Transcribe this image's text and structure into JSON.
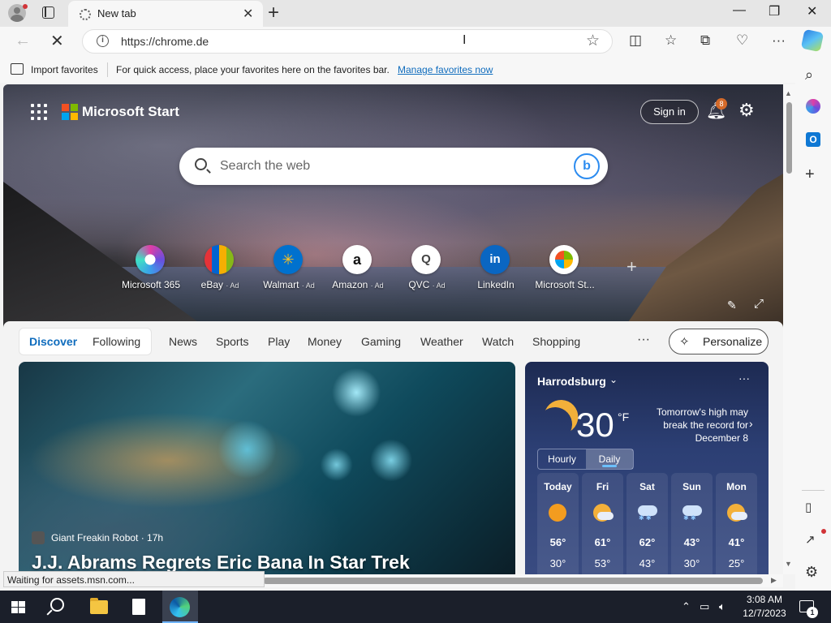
{
  "browser": {
    "tab": {
      "title": "New tab"
    },
    "address": {
      "url": "https://chrome.de"
    },
    "favorites_bar": {
      "import_label": "Import favorites",
      "message": "For quick access, place your favorites here on the favorites bar.",
      "manage_link": "Manage favorites now"
    },
    "status_text": "Waiting for assets.msn.com..."
  },
  "header": {
    "brand": "Microsoft Start",
    "sign_in": "Sign in",
    "notification_count": "8",
    "search_placeholder": "Search the web"
  },
  "quick_links": [
    {
      "label": "Microsoft 365",
      "ad": "",
      "icon": "m365-icon"
    },
    {
      "label": "eBay",
      "ad": "· Ad",
      "icon": "ebay-icon"
    },
    {
      "label": "Walmart",
      "ad": "· Ad",
      "icon": "walmart-icon"
    },
    {
      "label": "Amazon",
      "ad": "· Ad",
      "icon": "amazon-icon"
    },
    {
      "label": "QVC",
      "ad": "· Ad",
      "icon": "qvc-icon"
    },
    {
      "label": "LinkedIn",
      "ad": "",
      "icon": "linkedin-icon"
    },
    {
      "label": "Microsoft St...",
      "ad": "",
      "icon": "microsoft-store-icon"
    }
  ],
  "feed_nav": {
    "tabs": [
      "Discover",
      "Following"
    ],
    "items": [
      "News",
      "Sports",
      "Play",
      "Money",
      "Gaming",
      "Weather",
      "Watch",
      "Shopping"
    ],
    "more": "···",
    "personalize": "Personalize"
  },
  "article": {
    "source": "Giant Freakin Robot · 17h",
    "title": "J.J. Abrams Regrets Eric Bana In Star Trek"
  },
  "weather": {
    "location": "Harrodsburg",
    "temperature": "30",
    "unit": "°F",
    "note": "Tomorrow's high may break the record for December 8",
    "toggle": [
      "Hourly",
      "Daily"
    ],
    "days": [
      {
        "name": "Today",
        "high": "56°",
        "low": "30°",
        "icon": "sun"
      },
      {
        "name": "Fri",
        "high": "61°",
        "low": "53°",
        "icon": "partly-cloudy"
      },
      {
        "name": "Sat",
        "high": "62°",
        "low": "43°",
        "icon": "snow"
      },
      {
        "name": "Sun",
        "high": "43°",
        "low": "30°",
        "icon": "snow"
      },
      {
        "name": "Mon",
        "high": "41°",
        "low": "25°",
        "icon": "partly-cloudy"
      }
    ]
  },
  "taskbar": {
    "time": "3:08 AM",
    "date": "12/7/2023",
    "notification_count": "1"
  },
  "colors": {
    "accent": "#0f6cbd",
    "taskbar": "#1b1f2a",
    "weather_bg": "#2c3f74"
  }
}
